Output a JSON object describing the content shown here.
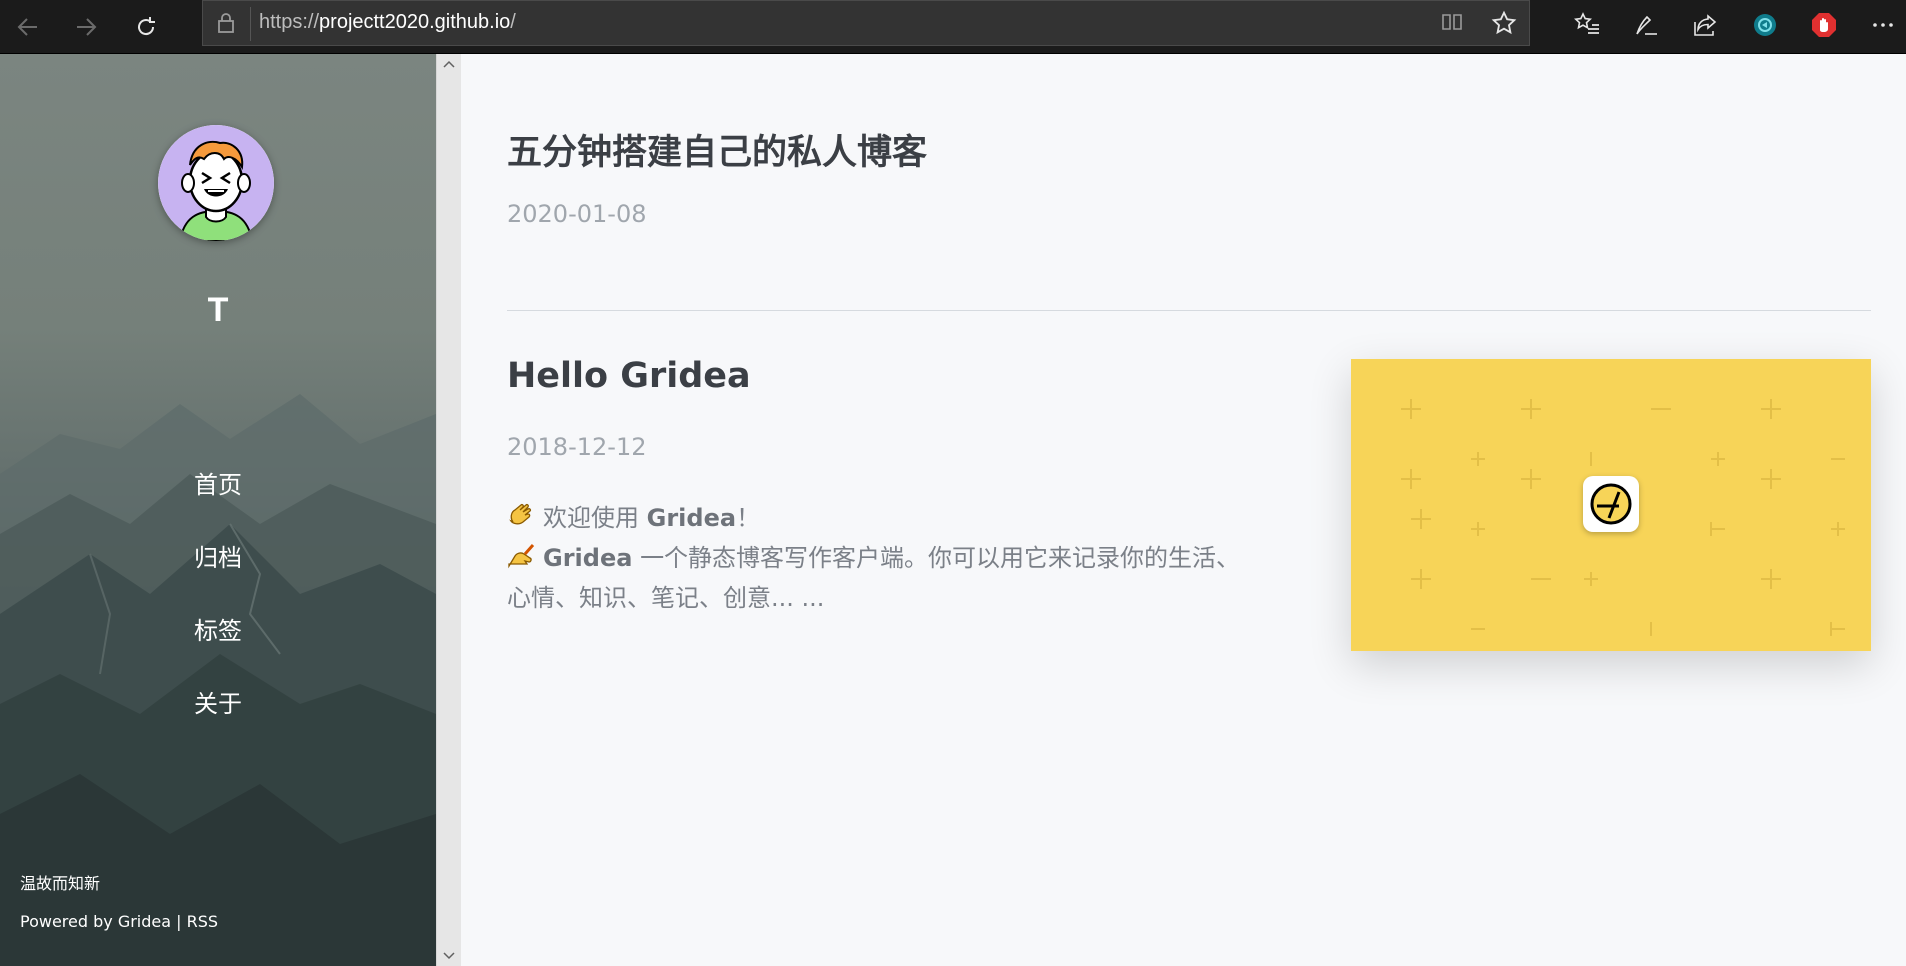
{
  "browser": {
    "url_scheme": "https://",
    "url_host": "projectt2020.github.io",
    "url_path": "/",
    "icons": [
      "back-icon",
      "forward-icon",
      "refresh-icon",
      "lock-icon",
      "reading-view-icon",
      "favorite-star-icon",
      "favorites-list-icon",
      "pen-icon",
      "share-icon",
      "extension-icon",
      "adblock-icon",
      "more-icon"
    ]
  },
  "sidebar": {
    "site_title": "T",
    "menu": [
      {
        "label": "首页"
      },
      {
        "label": "归档"
      },
      {
        "label": "标签"
      },
      {
        "label": "关于"
      }
    ],
    "motto": "温故而知新",
    "powered_by": "Powered by",
    "powered_link": "Gridea",
    "separator": "|",
    "rss": "RSS"
  },
  "posts": [
    {
      "title": "五分钟搭建自己的私人博客",
      "date": "2020-01-08"
    },
    {
      "title": "Hello Gridea",
      "date": "2018-12-12",
      "excerpt_line1_text": "欢迎使用",
      "excerpt_line1_bold": "Gridea",
      "excerpt_line1_end": "！",
      "excerpt_line2_bold": "Gridea",
      "excerpt_line2_text": "一个静态博客写作客户端。你可以用它来记录你的生活、",
      "excerpt_line3_text": "心情、知识、笔记、创意... ...",
      "feature_image_color": "#f7d458"
    }
  ],
  "colors": {
    "accent_yellow": "#f7d458",
    "title_text": "#3b3f45",
    "date_text": "#a0a6ad"
  }
}
